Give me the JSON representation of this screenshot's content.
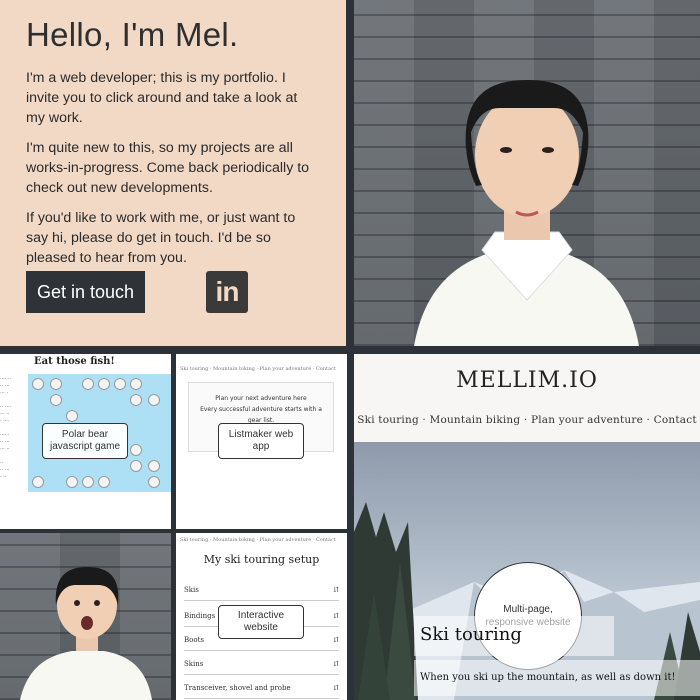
{
  "intro": {
    "heading": "Hello, I'm Mel.",
    "paragraphs": [
      "I'm a web developer; this is my portfolio. I invite you to click around and take a look at my work.",
      "I'm quite new to this, so my projects are all works-in-progress. Come back periodically to check out new developments.",
      "If you'd like to work with me, or just want to say hi, please do get in touch. I'd be so pleased to hear from you."
    ],
    "cta_label": "Get in touch",
    "linkedin_label": "in"
  },
  "projects": {
    "polar": {
      "title": "Eat those fish!",
      "label": "Polar bear javascript game"
    },
    "listmaker": {
      "nav": "Ski touring · Mountain biking · Plan your adventure · Contact",
      "line1": "Plan your next adventure here",
      "line2": "Every successful adventure starts with a gear list.",
      "label": "Listmaker web app"
    },
    "mellim": {
      "brand": "MELLIM.IO",
      "menu": [
        "Ski touring",
        "Mountain biking",
        "Plan your adventure",
        "Contact"
      ],
      "label": "Multi-page, responsive website",
      "banner_title": "Ski touring",
      "banner_text": "When you ski up the mountain, as well as down it!"
    },
    "skisetup": {
      "nav": "Ski touring · Mountain biking · Plan your adventure · Contact",
      "heading": "My ski touring setup",
      "rows": [
        "Skis",
        "Bindings",
        "Boots",
        "Skins",
        "Transceiver, shovel and probe"
      ],
      "label": "Interactive website"
    }
  },
  "colors": {
    "intro_bg": "#f2d9c6",
    "button_bg": "#2f3337",
    "page_bg": "#2d3239"
  }
}
